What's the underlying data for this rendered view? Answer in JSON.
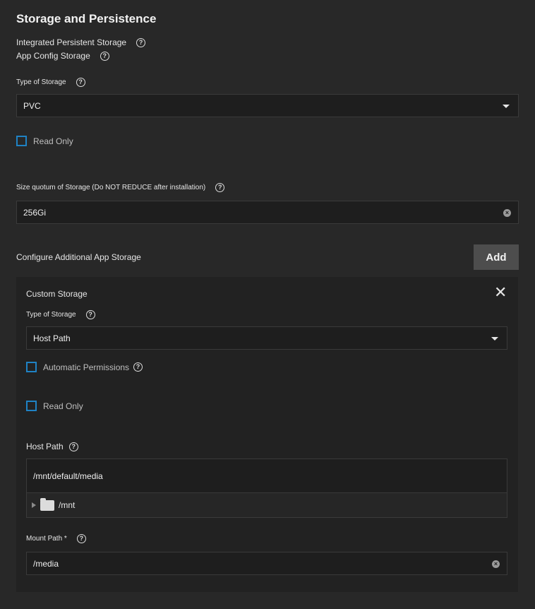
{
  "section": {
    "title": "Storage and Persistence",
    "integrated_label": "Integrated Persistent Storage",
    "app_config_label": "App Config Storage"
  },
  "app_config": {
    "type_label": "Type of Storage",
    "type_value": "PVC",
    "read_only_label": "Read Only",
    "read_only_checked": false,
    "size_label": "Size quotum of Storage (Do NOT REDUCE after installation)",
    "size_value": "256Gi"
  },
  "additional": {
    "label": "Configure Additional App Storage",
    "add_label": "Add"
  },
  "custom": {
    "title": "Custom Storage",
    "type_label": "Type of Storage",
    "type_value": "Host Path",
    "auto_perm_label": "Automatic Permissions",
    "auto_perm_checked": false,
    "read_only_label": "Read Only",
    "read_only_checked": false,
    "host_path_label": "Host Path",
    "host_path_value": "/mnt/default/media",
    "tree_item": "/mnt",
    "mount_path_label": "Mount Path *",
    "mount_path_value": "/media"
  },
  "icons": {
    "help": "?",
    "clear": "×",
    "close": "✕"
  },
  "colors": {
    "background": "#282828",
    "checkbox_border": "#1f82c4",
    "add_button": "#4d4d4d"
  }
}
